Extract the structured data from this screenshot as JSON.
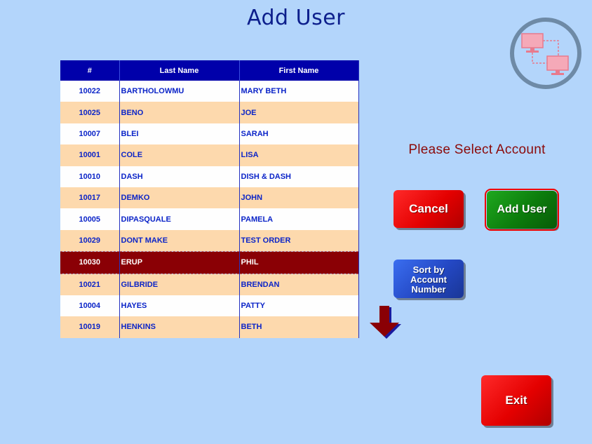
{
  "title": "Add User",
  "table": {
    "headers": [
      "#",
      "Last Name",
      "First Name"
    ],
    "rows": [
      {
        "num": "10022",
        "last": "BARTHOLOWMU",
        "first": "MARY BETH"
      },
      {
        "num": "10025",
        "last": "BENO",
        "first": "JOE"
      },
      {
        "num": "10007",
        "last": "BLEI",
        "first": "SARAH"
      },
      {
        "num": "10001",
        "last": "COLE",
        "first": "LISA"
      },
      {
        "num": "10010",
        "last": "DASH",
        "first": "DISH & DASH"
      },
      {
        "num": "10017",
        "last": "DEMKO",
        "first": "JOHN"
      },
      {
        "num": "10005",
        "last": "DIPASQUALE",
        "first": "PAMELA"
      },
      {
        "num": "10029",
        "last": "DONT MAKE",
        "first": "TEST ORDER"
      },
      {
        "num": "10030",
        "last": "ERUP",
        "first": "PHIL"
      },
      {
        "num": "10021",
        "last": "GILBRIDE",
        "first": "BRENDAN"
      },
      {
        "num": "10004",
        "last": "HAYES",
        "first": "PATTY"
      },
      {
        "num": "10019",
        "last": "HENKINS",
        "first": "BETH"
      }
    ],
    "selected_index": 8
  },
  "prompt": "Please Select Account",
  "buttons": {
    "cancel": "Cancel",
    "add_user": "Add User",
    "sort_line1": "Sort by",
    "sort_line2": "Account",
    "sort_line3": "Number",
    "exit": "Exit"
  },
  "icons": {
    "logo": "network-computers-icon",
    "scroll": "arrow-down-icon"
  },
  "colors": {
    "background": "#b3d5fb",
    "header": "#0000aa",
    "row_even": "#fdd9ad",
    "row_odd": "#fefefe",
    "selected": "#8a0005"
  }
}
